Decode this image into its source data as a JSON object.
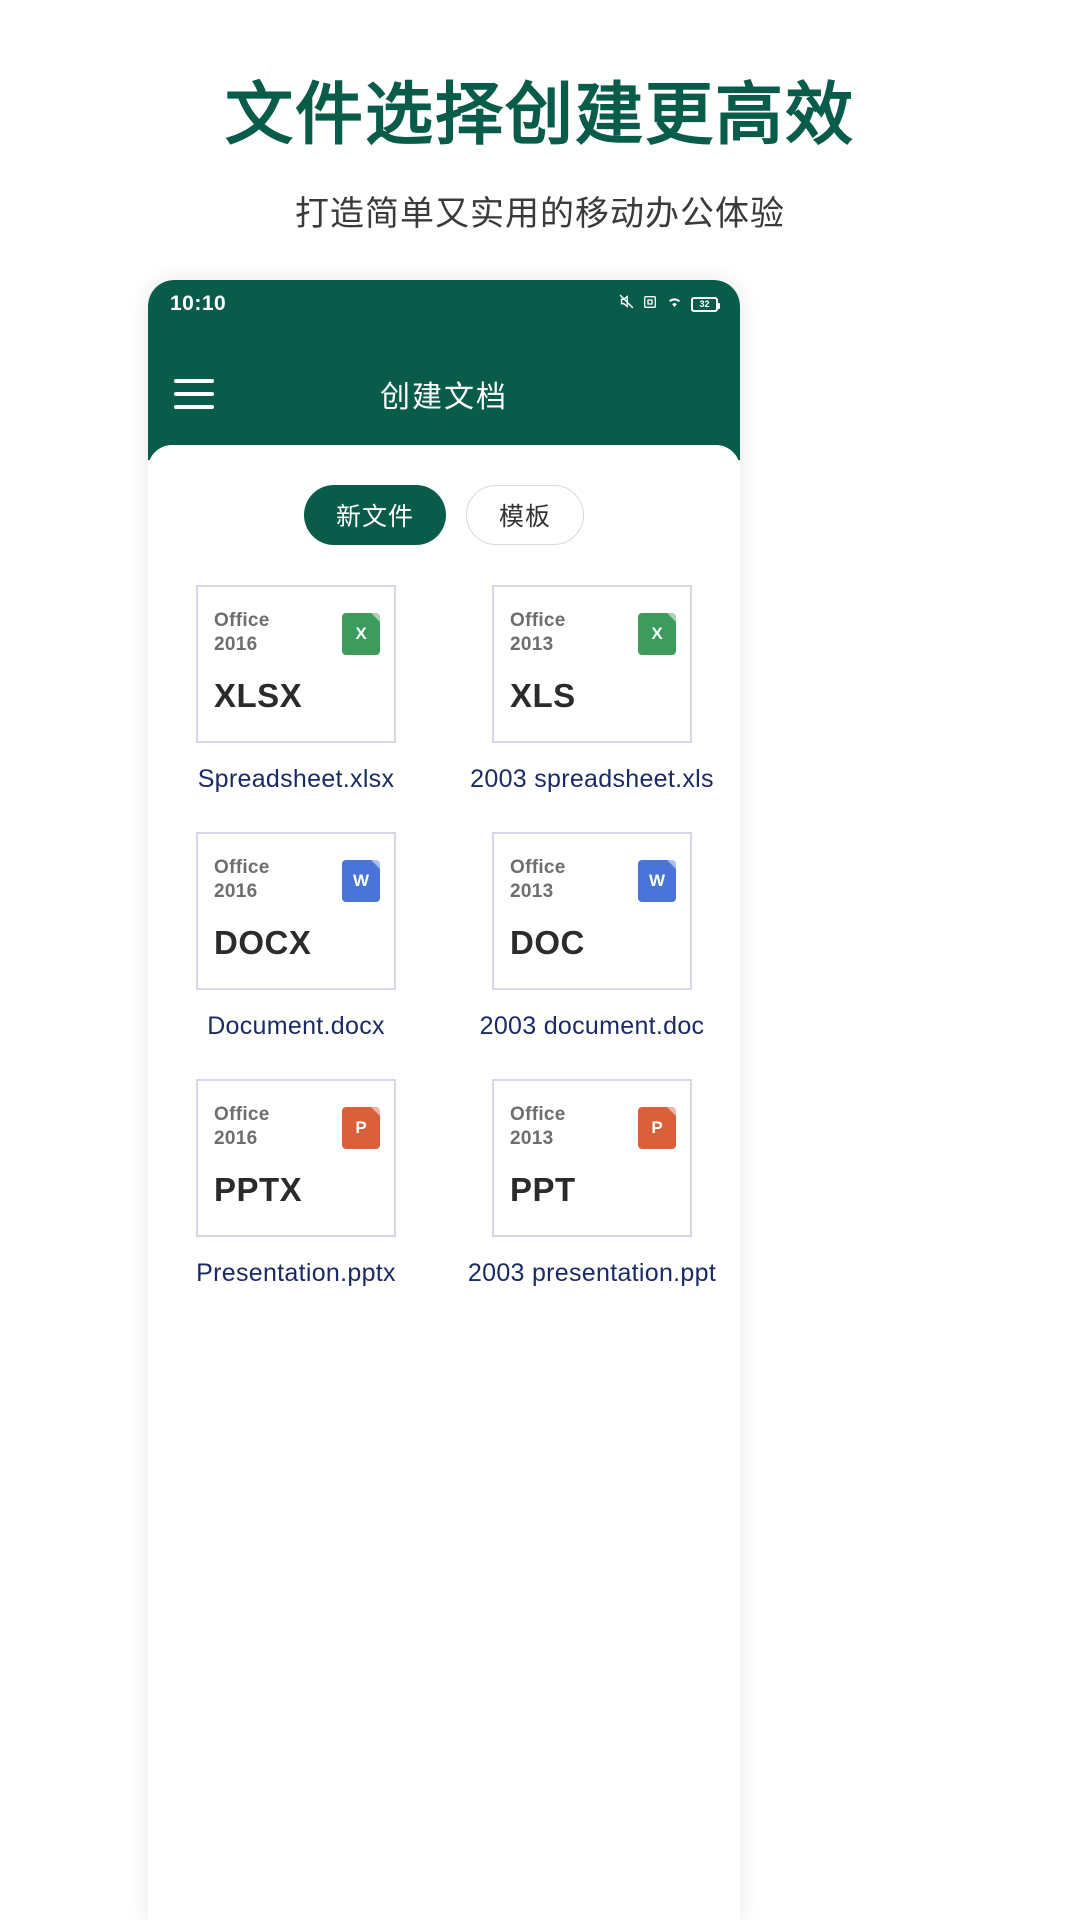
{
  "promo": {
    "headline": "文件选择创建更高效",
    "subhead": "打造简单又实用的移动办公体验",
    "headline_color": "#0a5c4a"
  },
  "phone": {
    "status": {
      "time": "10:10",
      "battery_level": "32",
      "icons": [
        "mute-icon",
        "screenshot-icon",
        "wifi-icon",
        "battery-icon"
      ]
    },
    "appbar": {
      "menu_icon": "hamburger-menu-icon",
      "title": "创建文档"
    },
    "tabs": [
      {
        "label": "新文件",
        "active": true
      },
      {
        "label": "模板",
        "active": false
      }
    ],
    "files": [
      {
        "office": "Office\n2016",
        "office_line1": "Office",
        "office_line2": "2016",
        "ext": "XLSX",
        "icon": "excel-icon",
        "icon_letter": "X",
        "icon_kind": "x",
        "name": "Spreadsheet.xlsx"
      },
      {
        "office_line1": "Office",
        "office_line2": "2013",
        "ext": "XLS",
        "icon": "excel-icon",
        "icon_letter": "X",
        "icon_kind": "x",
        "name": "2003  spreadsheet.xls"
      },
      {
        "office_line1": "Office",
        "office_line2": "2016",
        "ext": "DOCX",
        "icon": "word-icon",
        "icon_letter": "W",
        "icon_kind": "w",
        "name": "Document.docx"
      },
      {
        "office_line1": "Office",
        "office_line2": "2013",
        "ext": "DOC",
        "icon": "word-icon",
        "icon_letter": "W",
        "icon_kind": "w",
        "name": "2003  document.doc"
      },
      {
        "office_line1": "Office",
        "office_line2": "2016",
        "ext": "PPTX",
        "icon": "powerpoint-icon",
        "icon_letter": "P",
        "icon_kind": "p",
        "name": "Presentation.pptx"
      },
      {
        "office_line1": "Office",
        "office_line2": "2013",
        "ext": "PPT",
        "icon": "powerpoint-icon",
        "icon_letter": "P",
        "icon_kind": "p",
        "name": "2003  presentation.ppt"
      }
    ],
    "colors": {
      "brand_green": "#0a5c4a",
      "card_border": "#d6d7ea",
      "filename_blue": "#1b2a63",
      "excel_green": "#3c9b5d",
      "word_blue": "#4a74d8",
      "ppt_orange": "#d9603a"
    }
  }
}
